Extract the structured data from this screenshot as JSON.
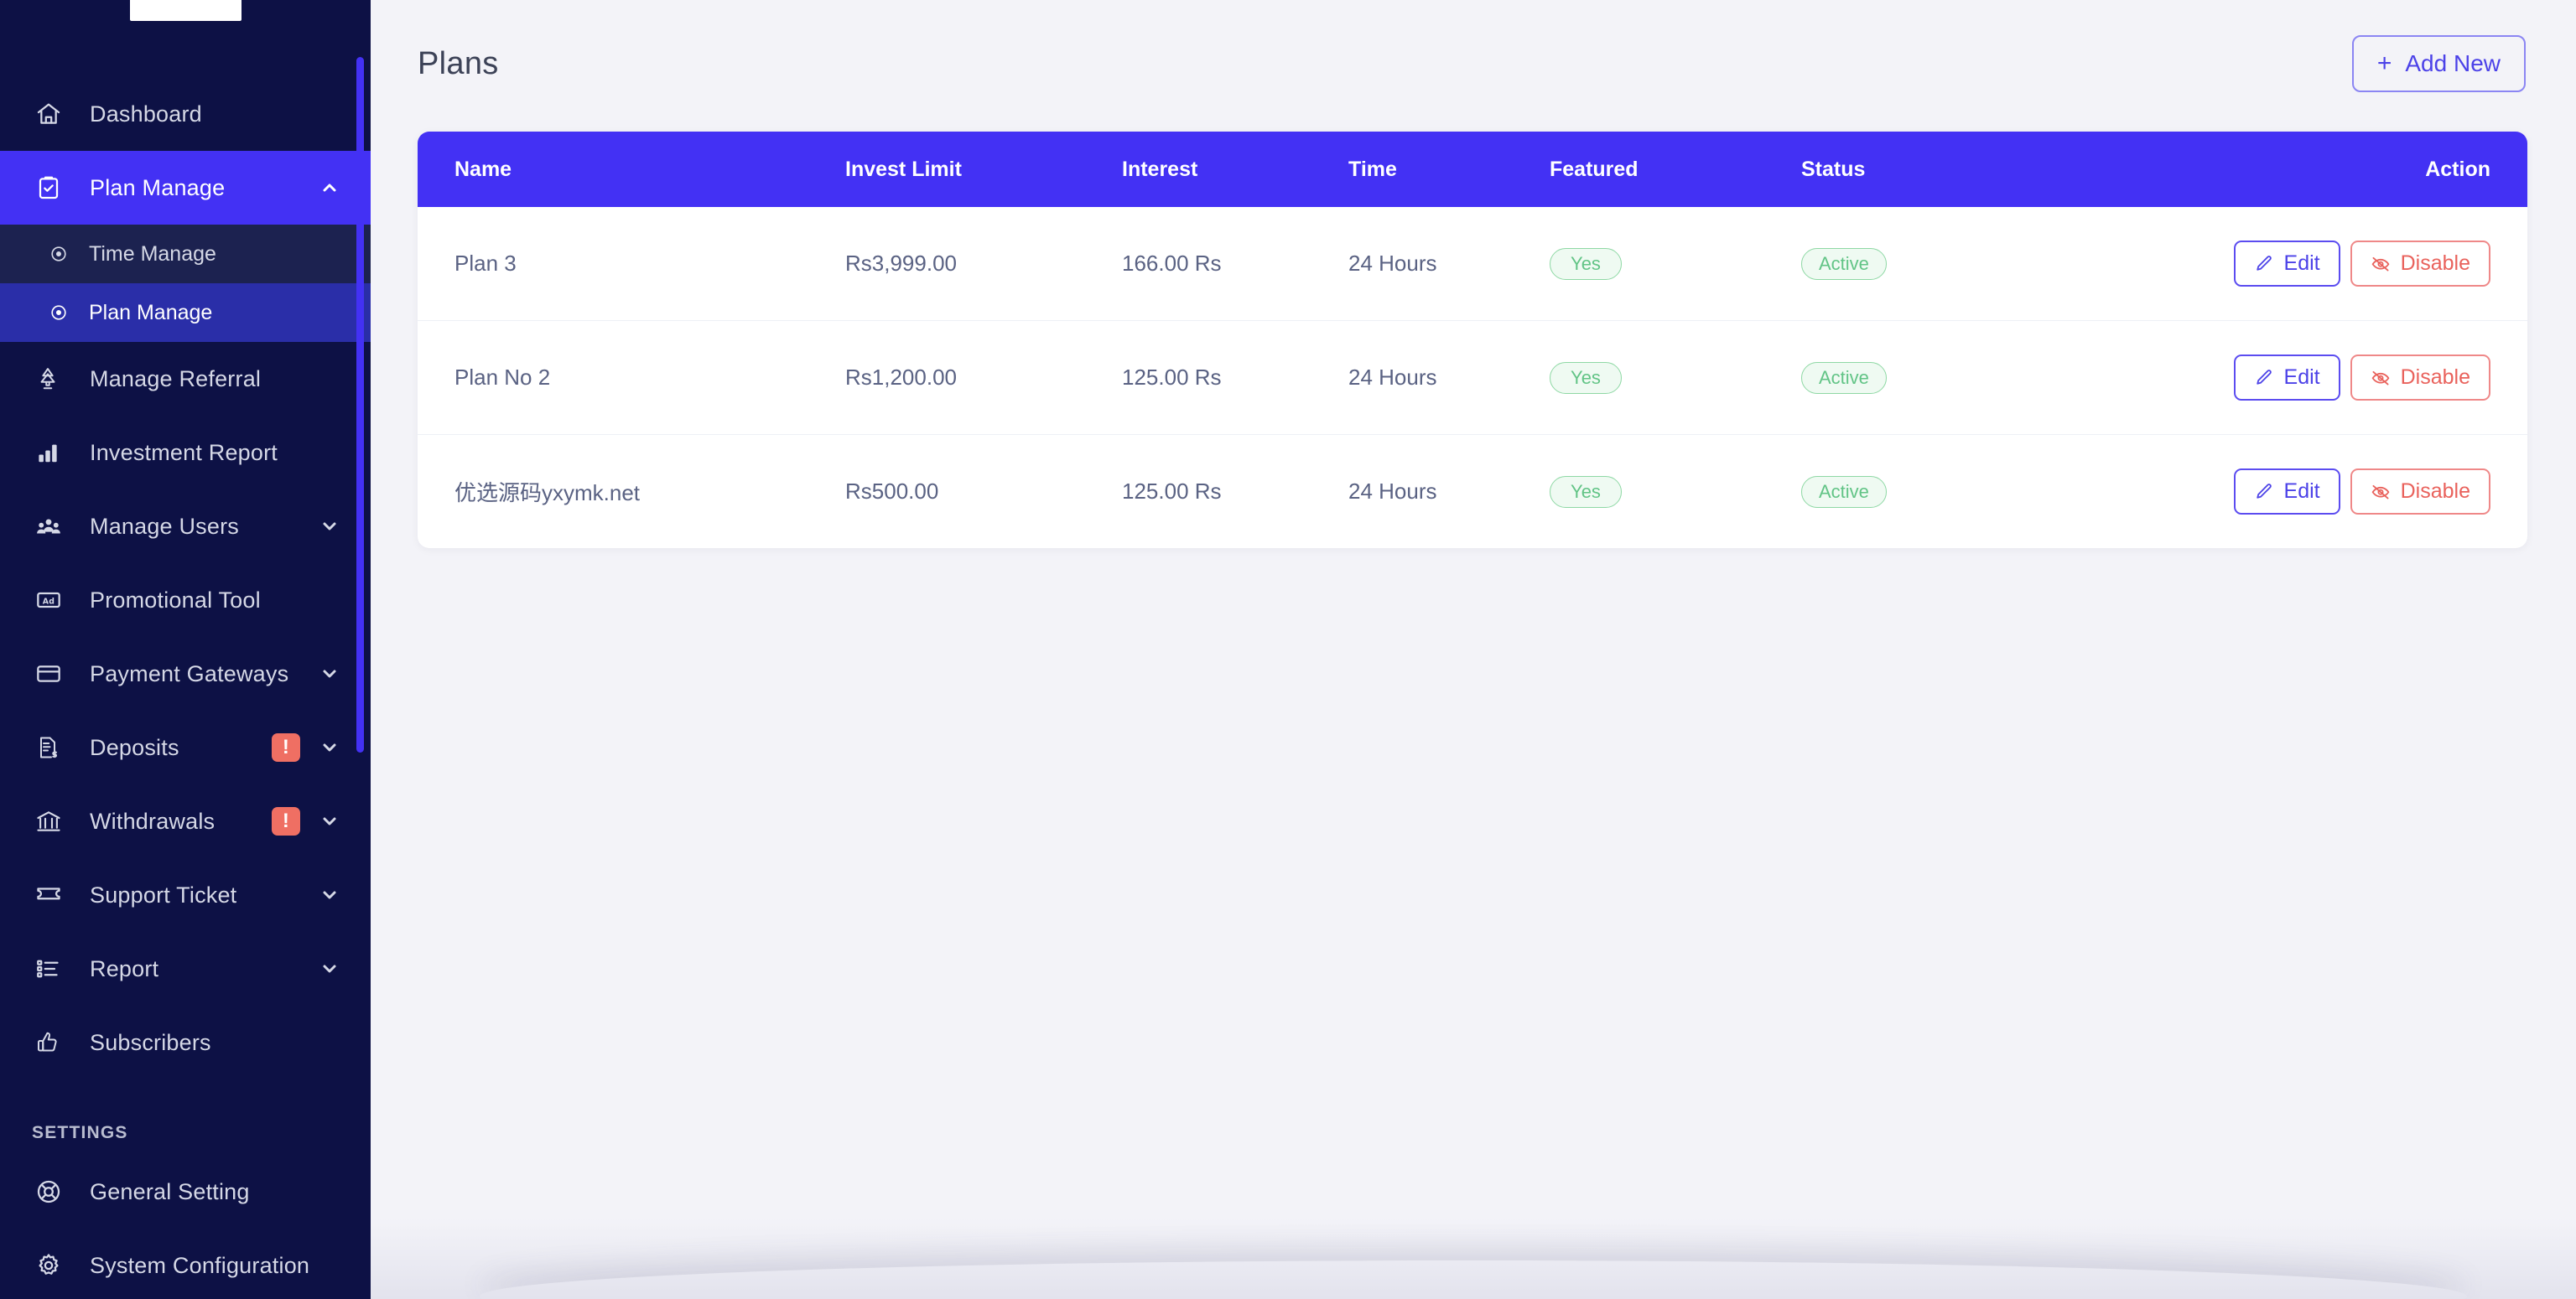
{
  "sidebar": {
    "logo": "brand-logo",
    "items": [
      {
        "label": "Dashboard",
        "icon": "home-icon",
        "state": "default",
        "chevron": "none",
        "badge": null
      },
      {
        "label": "Plan Manage",
        "icon": "clipboard-check-icon",
        "state": "active",
        "chevron": "up",
        "badge": null
      },
      {
        "label": "Manage Referral",
        "icon": "referral-tree-icon",
        "state": "default",
        "chevron": "none",
        "badge": null
      },
      {
        "label": "Investment Report",
        "icon": "bar-chart-icon",
        "state": "default",
        "chevron": "none",
        "badge": null
      },
      {
        "label": "Manage Users",
        "icon": "users-icon",
        "state": "default",
        "chevron": "down",
        "badge": null
      },
      {
        "label": "Promotional Tool",
        "icon": "ad-banner-icon",
        "state": "default",
        "chevron": "none",
        "badge": null
      },
      {
        "label": "Payment Gateways",
        "icon": "credit-card-icon",
        "state": "default",
        "chevron": "down",
        "badge": null
      },
      {
        "label": "Deposits",
        "icon": "document-dollar-icon",
        "state": "default",
        "chevron": "down",
        "badge": "!"
      },
      {
        "label": "Withdrawals",
        "icon": "bank-icon",
        "state": "default",
        "chevron": "down",
        "badge": "!"
      },
      {
        "label": "Support Ticket",
        "icon": "ticket-icon",
        "state": "default",
        "chevron": "down",
        "badge": null
      },
      {
        "label": "Report",
        "icon": "list-icon",
        "state": "default",
        "chevron": "down",
        "badge": null
      },
      {
        "label": "Subscribers",
        "icon": "thumbs-up-icon",
        "state": "default",
        "chevron": "none",
        "badge": null
      }
    ],
    "submenu": [
      {
        "label": "Time Manage",
        "icon": "dot-circle-icon",
        "state": "default"
      },
      {
        "label": "Plan Manage",
        "icon": "dot-circle-icon",
        "state": "current"
      }
    ],
    "settings_heading": "SETTINGS",
    "settings_items": [
      {
        "label": "General Setting",
        "icon": "lifebuoy-icon"
      },
      {
        "label": "System Configuration",
        "icon": "gear-icon"
      }
    ],
    "colors": {
      "background": "#0d1145",
      "active": "#4331f4",
      "submenu_bg": "#1c2250",
      "submenu_current": "#2a2ea8",
      "badge": "#ef6f63",
      "scrollbar": "#4331f4"
    }
  },
  "header": {
    "title": "Plans",
    "add_new_label": "Add New",
    "add_new_icon": "plus-icon"
  },
  "table": {
    "columns": [
      "Name",
      "Invest Limit",
      "Interest",
      "Time",
      "Featured",
      "Status",
      "Action"
    ],
    "rows": [
      {
        "name": "Plan 3",
        "invest_limit": "Rs3,999.00",
        "interest": "166.00 Rs",
        "time": "24 Hours",
        "featured": "Yes",
        "status": "Active",
        "edit_label": "Edit",
        "disable_label": "Disable"
      },
      {
        "name": "Plan No 2",
        "invest_limit": "Rs1,200.00",
        "interest": "125.00 Rs",
        "time": "24 Hours",
        "featured": "Yes",
        "status": "Active",
        "edit_label": "Edit",
        "disable_label": "Disable"
      },
      {
        "name": "优选源码yxymk.net",
        "invest_limit": "Rs500.00",
        "interest": "125.00 Rs",
        "time": "24 Hours",
        "featured": "Yes",
        "status": "Active",
        "edit_label": "Edit",
        "disable_label": "Disable"
      }
    ],
    "colors": {
      "header_bg": "#4331f4",
      "pill_border": "#8ed8a4",
      "pill_text": "#62c486",
      "edit": "#4c42e8",
      "disable": "#e9625c"
    }
  }
}
